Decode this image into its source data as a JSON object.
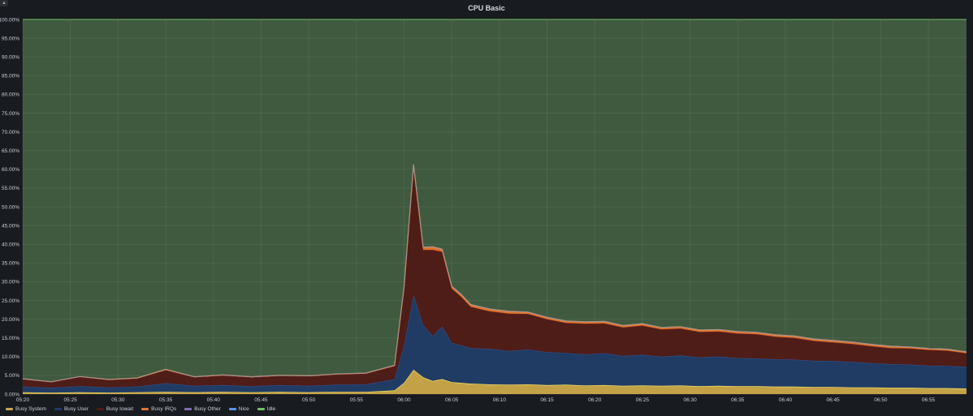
{
  "panel": {
    "title": "CPU Basic",
    "corner_icon": "panel-menu-icon"
  },
  "chart_data": {
    "type": "area",
    "stacked": true,
    "title": "CPU Basic",
    "ylim": [
      0,
      100
    ],
    "yticks": [
      "0.00%",
      "5.00%",
      "10.00%",
      "15.00%",
      "20.00%",
      "25.00%",
      "30.00%",
      "35.00%",
      "40.00%",
      "45.00%",
      "50.00%",
      "55.00%",
      "60.00%",
      "65.00%",
      "70.00%",
      "75.00%",
      "80.00%",
      "85.00%",
      "90.00%",
      "95.00%",
      "100.00%"
    ],
    "xticks": [
      "05:20",
      "05:25",
      "05:30",
      "05:35",
      "05:40",
      "05:45",
      "05:50",
      "05:55",
      "06:00",
      "06:05",
      "06:10",
      "06:15",
      "06:20",
      "06:25",
      "06:30",
      "06:35",
      "06:40",
      "06:45",
      "06:50",
      "06:55"
    ],
    "x_start": "05:20",
    "x_end": "06:59",
    "grid": true,
    "legend_position": "bottom-left",
    "x": [
      "05:20",
      "05:23",
      "05:26",
      "05:29",
      "05:32",
      "05:35",
      "05:38",
      "05:41",
      "05:44",
      "05:47",
      "05:50",
      "05:53",
      "05:56",
      "05:59",
      "06:00",
      "06:01",
      "06:02",
      "06:03",
      "06:04",
      "06:05",
      "06:06",
      "06:07",
      "06:09",
      "06:11",
      "06:13",
      "06:15",
      "06:17",
      "06:19",
      "06:21",
      "06:23",
      "06:25",
      "06:27",
      "06:29",
      "06:31",
      "06:33",
      "06:35",
      "06:37",
      "06:39",
      "06:41",
      "06:43",
      "06:45",
      "06:47",
      "06:49",
      "06:51",
      "06:53",
      "06:55",
      "06:57",
      "06:59"
    ],
    "series": [
      {
        "name": "Busy System",
        "color": "#caa648",
        "values": [
          0.5,
          0.4,
          0.5,
          0.4,
          0.5,
          0.6,
          0.5,
          0.6,
          0.5,
          0.6,
          0.5,
          0.6,
          0.6,
          1.0,
          3.0,
          6.5,
          4.5,
          3.5,
          4.0,
          3.2,
          3.0,
          2.8,
          2.6,
          2.5,
          2.6,
          2.4,
          2.5,
          2.3,
          2.4,
          2.2,
          2.3,
          2.2,
          2.3,
          2.1,
          2.2,
          2.1,
          2.1,
          2.0,
          2.0,
          1.9,
          1.9,
          1.8,
          1.8,
          1.7,
          1.7,
          1.6,
          1.6,
          1.5
        ]
      },
      {
        "name": "Busy User",
        "color": "#1f3a66",
        "values": [
          1.5,
          1.3,
          1.6,
          1.4,
          1.5,
          2.3,
          1.7,
          1.8,
          1.6,
          1.8,
          1.7,
          1.9,
          2.0,
          3.0,
          10.0,
          20.0,
          14.0,
          12.0,
          14.0,
          10.5,
          10.0,
          9.5,
          9.5,
          9.0,
          9.3,
          8.8,
          8.5,
          8.3,
          8.5,
          8.0,
          8.2,
          7.8,
          8.0,
          7.7,
          7.8,
          7.5,
          7.4,
          7.3,
          7.2,
          7.0,
          6.9,
          6.8,
          6.5,
          6.3,
          6.2,
          6.0,
          5.9,
          5.8
        ]
      },
      {
        "name": "Busy Iowait",
        "color": "#501a16",
        "values": [
          2.0,
          1.5,
          2.5,
          2.0,
          2.2,
          3.5,
          2.3,
          2.6,
          2.4,
          2.5,
          2.6,
          2.8,
          2.9,
          3.5,
          15.0,
          34.0,
          20.0,
          23.0,
          20.0,
          14.5,
          13.0,
          11.0,
          10.0,
          10.0,
          9.5,
          8.8,
          8.0,
          8.2,
          8.0,
          7.6,
          7.8,
          7.3,
          7.2,
          6.8,
          6.7,
          6.6,
          6.5,
          6.0,
          5.8,
          5.3,
          5.0,
          4.8,
          4.5,
          4.3,
          4.3,
          4.2,
          4.1,
          3.6
        ]
      },
      {
        "name": "Busy IRQs",
        "color": "#e0752d",
        "values": [
          0.1,
          0.1,
          0.1,
          0.1,
          0.1,
          0.2,
          0.1,
          0.1,
          0.1,
          0.1,
          0.1,
          0.1,
          0.1,
          0.2,
          0.6,
          0.8,
          0.7,
          0.8,
          0.7,
          0.6,
          0.6,
          0.6,
          0.6,
          0.6,
          0.5,
          0.5,
          0.5,
          0.5,
          0.5,
          0.5,
          0.5,
          0.5,
          0.5,
          0.5,
          0.5,
          0.5,
          0.5,
          0.5,
          0.5,
          0.5,
          0.5,
          0.5,
          0.5,
          0.5,
          0.4,
          0.4,
          0.4,
          0.4
        ]
      },
      {
        "name": "Busy Other",
        "color": "#806eb7",
        "values": [
          0.0,
          0.0,
          0.0,
          0.0,
          0.0,
          0.0,
          0.0,
          0.0,
          0.0,
          0.0,
          0.0,
          0.0,
          0.0,
          0.0,
          0.0,
          0.0,
          0.0,
          0.0,
          0.0,
          0.0,
          0.0,
          0.0,
          0.0,
          0.0,
          0.0,
          0.0,
          0.0,
          0.0,
          0.0,
          0.0,
          0.0,
          0.0,
          0.0,
          0.0,
          0.0,
          0.0,
          0.0,
          0.0,
          0.0,
          0.0,
          0.0,
          0.0,
          0.0,
          0.0,
          0.0,
          0.0,
          0.0,
          0.0
        ]
      },
      {
        "name": "Nice",
        "color": "#5794f2",
        "values": [
          0.0,
          0.0,
          0.0,
          0.0,
          0.0,
          0.0,
          0.0,
          0.0,
          0.0,
          0.0,
          0.0,
          0.0,
          0.0,
          0.0,
          0.0,
          0.0,
          0.0,
          0.0,
          0.0,
          0.0,
          0.0,
          0.0,
          0.0,
          0.0,
          0.0,
          0.0,
          0.0,
          0.0,
          0.0,
          0.0,
          0.0,
          0.0,
          0.0,
          0.0,
          0.0,
          0.0,
          0.0,
          0.0,
          0.0,
          0.0,
          0.0,
          0.0,
          0.0,
          0.0,
          0.0,
          0.0,
          0.0,
          0.0
        ]
      },
      {
        "name": "Idle",
        "color": "#3f5a3f",
        "line_color": "#73bf69",
        "fill": "remainder"
      }
    ]
  }
}
